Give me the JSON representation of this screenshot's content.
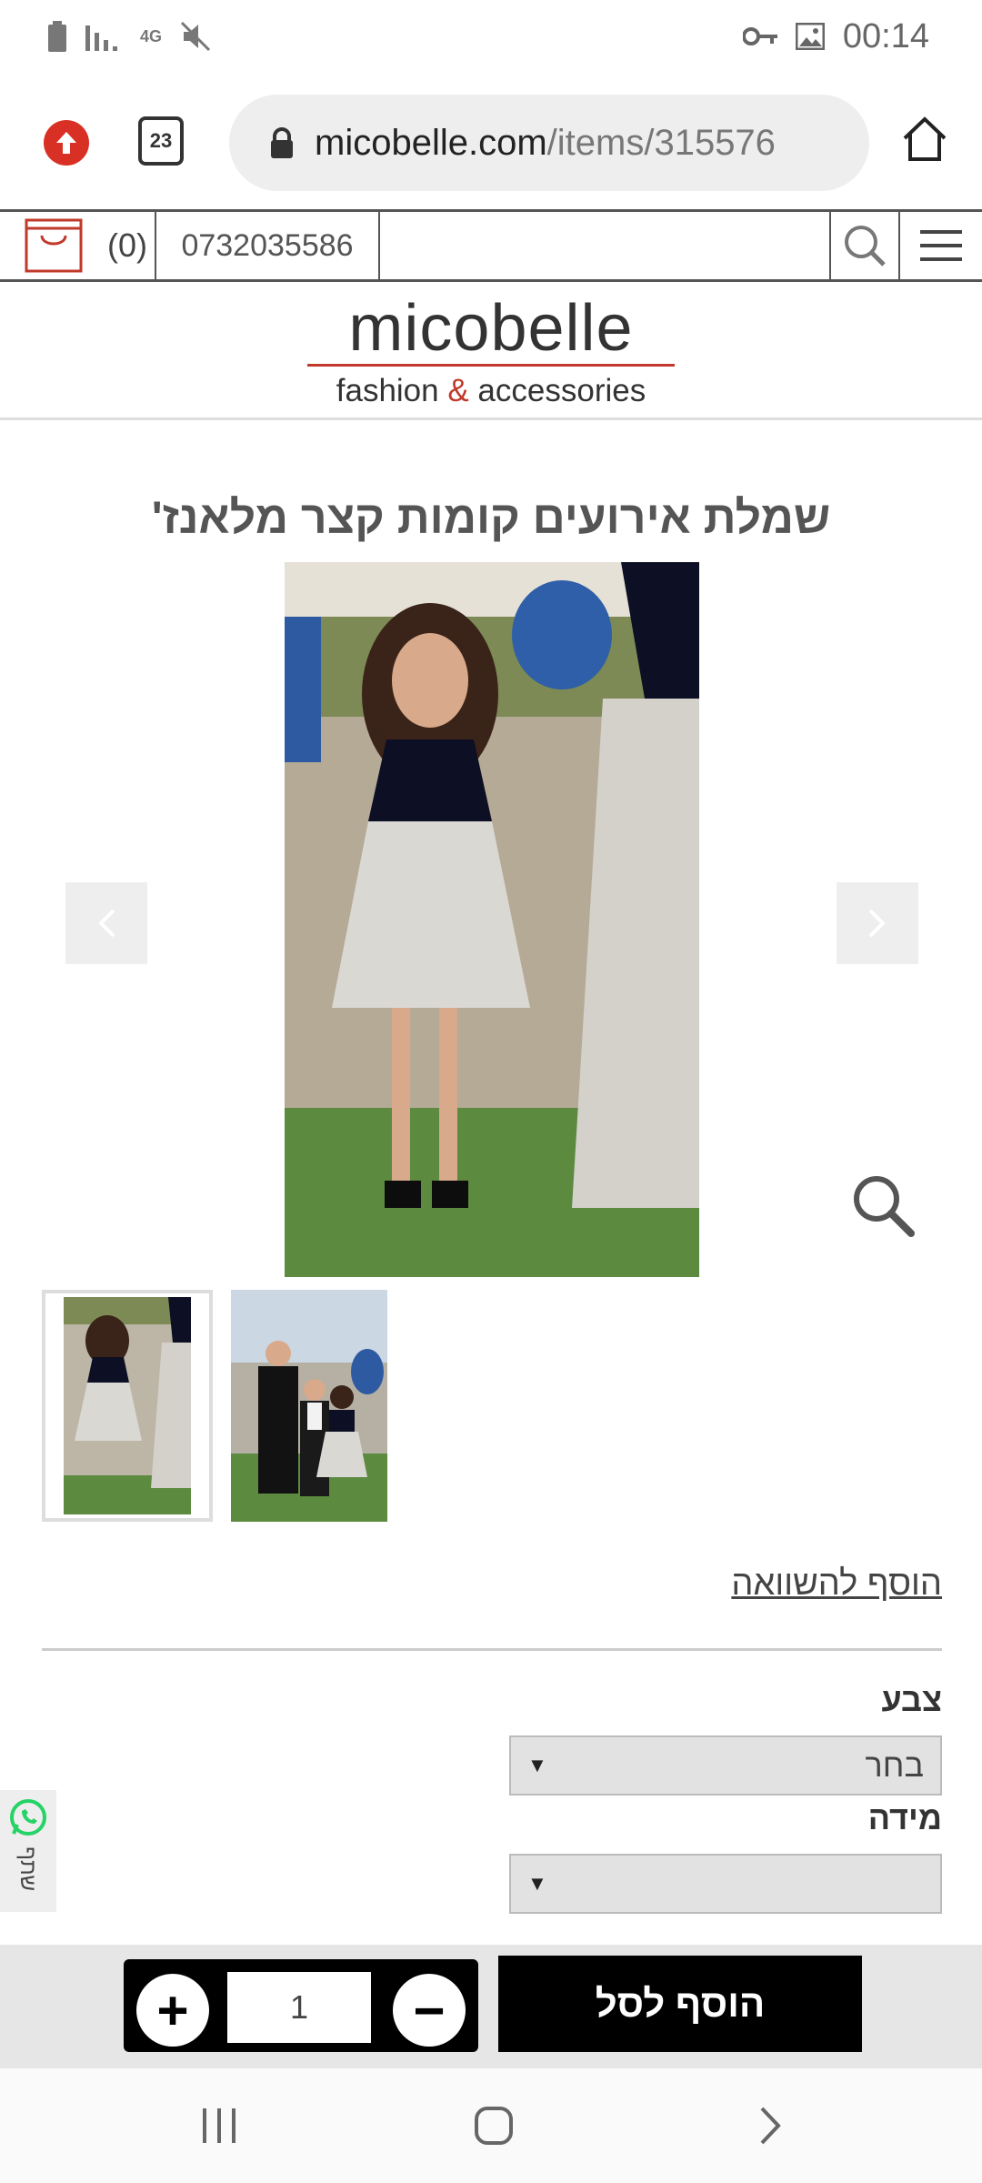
{
  "status_bar": {
    "time": "00:14",
    "network": "4G"
  },
  "browser": {
    "tab_count": "23",
    "url_domain": "micobelle.com",
    "url_path": "/items/315576",
    "icons": [
      "upload-icon",
      "tabs-icon",
      "lock-icon",
      "home-icon"
    ]
  },
  "site_header": {
    "cart_count": "(0)",
    "phone": "0732035586",
    "search_placeholder": ""
  },
  "logo": {
    "name": "micobelle",
    "tagline_part1": "fashion ",
    "tagline_amp": "&",
    "tagline_part2": " accessories"
  },
  "product": {
    "title": "שמלת אירועים קומות קצר מלאנז'",
    "compare_link": "הוסף להשוואה",
    "color_label": "צבע",
    "color_value": "בחר",
    "size_label": "מידה",
    "size_value": "",
    "quantity": "1",
    "add_to_cart": "הוסף לסל",
    "share_label": "שתף"
  },
  "colors": {
    "accent_red": "#c0392b",
    "whatsapp_green": "#25d366",
    "cart_button": "#000000"
  }
}
